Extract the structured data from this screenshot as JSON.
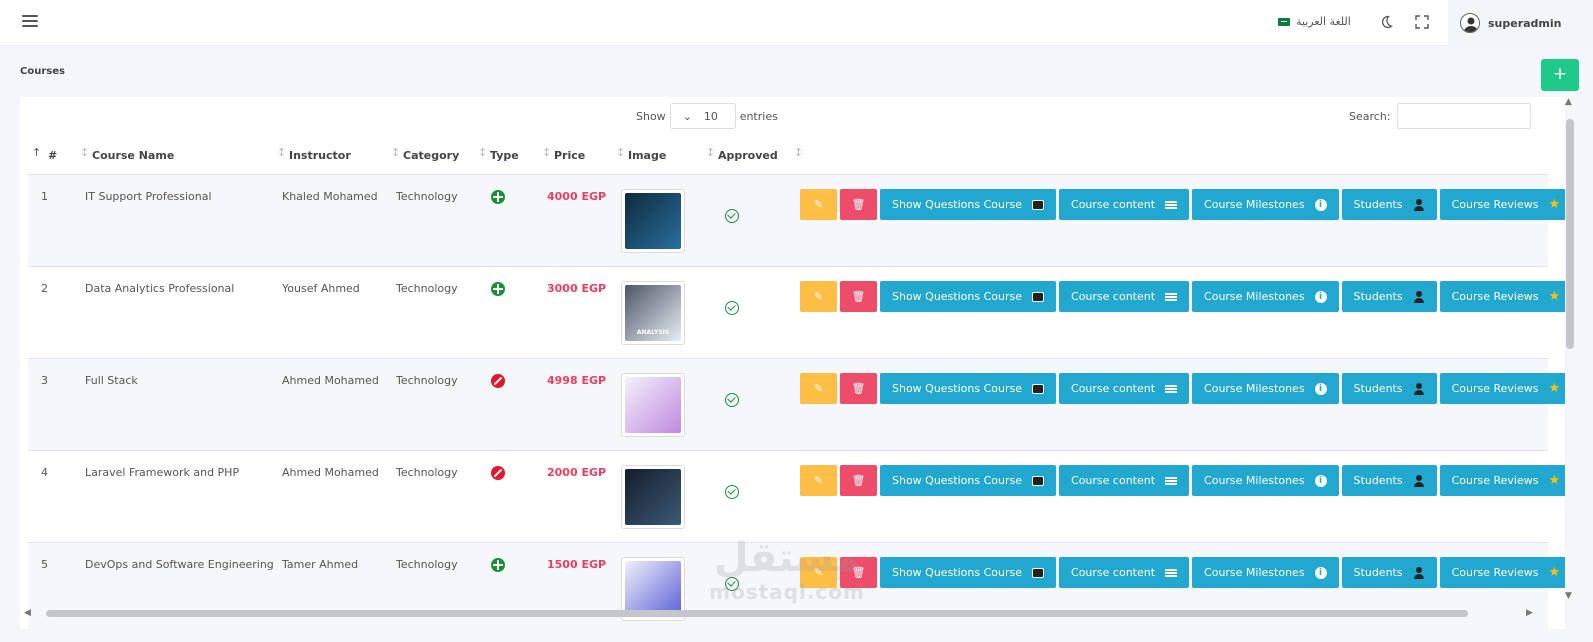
{
  "navbar": {
    "language_label": "اللغة العربية",
    "username": "superadmin"
  },
  "page": {
    "title": "Courses",
    "add_label": "+"
  },
  "table_controls": {
    "show_label": "Show",
    "entries_value": "10",
    "entries_label": "entries",
    "search_label": "Search:"
  },
  "columns": [
    "#",
    "Course Name",
    "Instructor",
    "Category",
    "Type",
    "Price",
    "Image",
    "Approved"
  ],
  "action_labels": {
    "show_questions": "Show Questions Course",
    "course_content": "Course content",
    "course_milestones": "Course Milestones",
    "students": "Students",
    "course_reviews": "Course Reviews"
  },
  "rows": [
    {
      "num": "1",
      "name": "IT Support Professional",
      "instructor": "Khaled Mohamed",
      "category": "Technology",
      "type": "online",
      "price": "4000 EGP",
      "approved": true,
      "image_colors": [
        "#0e2a3a",
        "#2a6fa0"
      ]
    },
    {
      "num": "2",
      "name": "Data Analytics Professional",
      "instructor": "Yousef Ahmed",
      "category": "Technology",
      "type": "online",
      "price": "3000 EGP",
      "approved": true,
      "image_colors": [
        "#4d5566",
        "#e8eef4"
      ],
      "image_caption": "ANALYSIS"
    },
    {
      "num": "3",
      "name": "Full Stack",
      "instructor": "Ahmed Mohamed",
      "category": "Technology",
      "type": "offline",
      "price": "4998 EGP",
      "approved": true,
      "image_colors": [
        "#f4f1fb",
        "#c08ae0"
      ]
    },
    {
      "num": "4",
      "name": "Laravel Framework and PHP",
      "instructor": "Ahmed Mohamed",
      "category": "Technology",
      "type": "offline",
      "price": "2000 EGP",
      "approved": true,
      "image_colors": [
        "#141d2a",
        "#3c5a78"
      ]
    },
    {
      "num": "5",
      "name": "DevOps and Software Engineering",
      "instructor": "Tamer Ahmed",
      "category": "Technology",
      "type": "online",
      "price": "1500 EGP",
      "approved": true,
      "image_colors": [
        "#eef0fb",
        "#5b5fd6"
      ]
    }
  ],
  "watermark": {
    "arabic": "مستقل",
    "latin": "mostaql.com"
  },
  "colors": {
    "accent": "#22a8cf",
    "edit": "#ffbe45",
    "delete": "#ee4d6a",
    "add": "#1ec989",
    "price": "#ee3e60"
  }
}
